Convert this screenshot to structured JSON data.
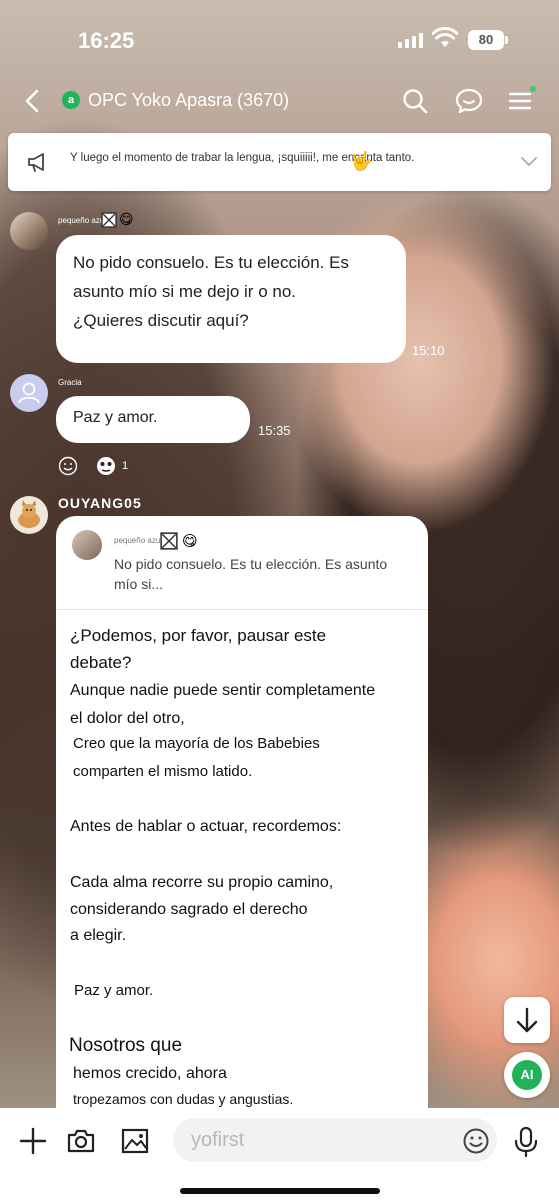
{
  "status_bar": {
    "time": "16:25",
    "battery": "80"
  },
  "header": {
    "group_icon": "a",
    "title": "OPC Yoko Apasra (3670)"
  },
  "announcement": {
    "text": "Y luego el momento de trabar la lengua, ¡squiiiii!, me encanta tanto.",
    "emoji": "🤟"
  },
  "messages": [
    {
      "sender": "pequeño azul n",
      "sender_emoji": "😋",
      "lines": [
        "No pido consuelo. Es tu elección. Es",
        "asunto mío si me dejo ir o no.",
        "¿Quieres discutir aquí?"
      ],
      "time": "15:10"
    },
    {
      "sender": "Gracia",
      "lines": [
        "Paz y amor."
      ],
      "time": "15:35",
      "reaction_count": "1"
    },
    {
      "sender": "OUYANG05",
      "quote": {
        "name": "pequeño azul n",
        "emoji": "😋",
        "text": "No pido consuelo. Es tu elección. Es asunto mío si..."
      },
      "lines": [
        "¿Podemos, por favor, pausar este",
        "debate?",
        "Aunque nadie puede sentir completamente",
        "el dolor del otro,",
        "Creo que la mayoría de los Babebies",
        "comparten el mismo latido.",
        "Antes de hablar o actuar, recordemos:",
        "Cada alma recorre su propio camino,",
        "considerando sagrado el derecho",
        "a elegir.",
        "Paz y amor.",
        "Nosotros que",
        "hemos crecido, ahora",
        "tropezamos con dudas y angustias."
      ]
    }
  ],
  "fab": {
    "ai_label": "AI"
  },
  "input": {
    "placeholder": "yofirst"
  },
  "icons": {
    "back": "chevron-left-icon",
    "search": "search-icon",
    "chat": "chat-icon",
    "menu": "menu-icon",
    "megaphone": "megaphone-icon",
    "scroll_down": "arrow-down-icon",
    "plus": "plus-icon",
    "camera": "camera-icon",
    "image": "image-icon",
    "emoji": "emoji-icon",
    "mic": "mic-icon"
  },
  "colors": {
    "accent_green": "#21b25a",
    "bubble": "#ffffff"
  }
}
